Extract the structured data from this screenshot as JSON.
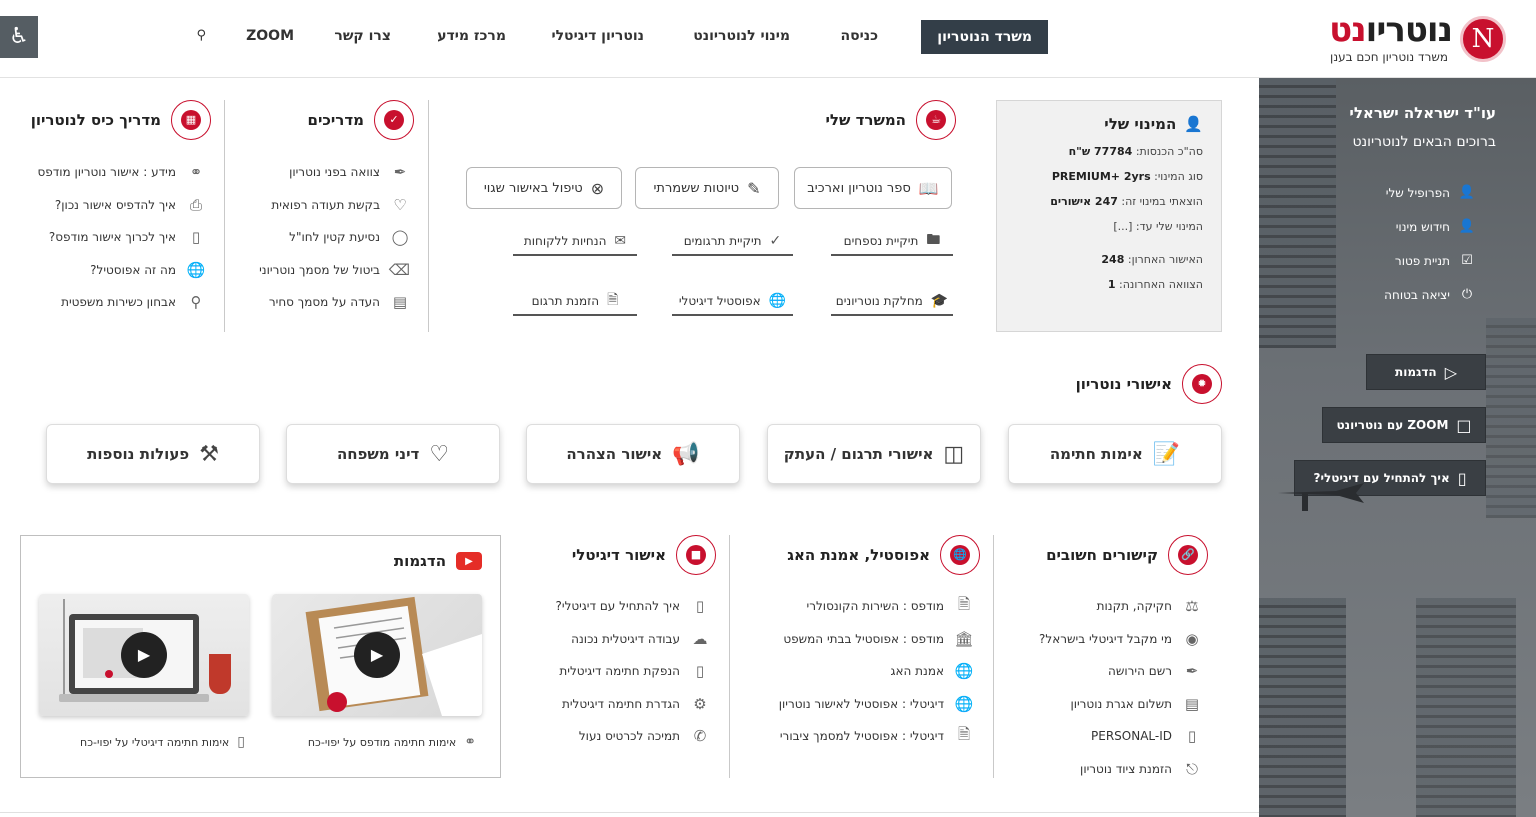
{
  "header": {
    "logo_main": "נוטריו",
    "logo_tail": "נט",
    "logo_letter": "N",
    "logo_sub": "משרד נוטריון חכם בענן",
    "nav_primary": "משרד הנוטריון",
    "nav": [
      "כניסה",
      "מינוי לנוטריונט",
      "נוטריון דיגיטלי",
      "מרכז מידע",
      "צרו קשר",
      "ZOOM"
    ],
    "search_icon": "search-icon",
    "accessibility_icon": "wheelchair-icon"
  },
  "sidebar": {
    "greeting": "עו\"ד ישראלה ישראלי",
    "welcome": "ברוכים הבאים לנוטריונט",
    "items": [
      {
        "label": "הפרופיל שלי",
        "icon": "user-gear-icon"
      },
      {
        "label": "חידוש מינוי",
        "icon": "user-plus-icon"
      },
      {
        "label": "תניית פטור",
        "icon": "checkbox-icon"
      },
      {
        "label": "יציאה בטוחה",
        "icon": "power-icon"
      }
    ],
    "buttons": [
      {
        "label": "הדגמות",
        "icon": "play-circle-icon"
      },
      {
        "label": "ZOOM עם נוטריונט",
        "icon": "video-camera-icon"
      },
      {
        "label": "איך להתחיל עם דיגיטלי?",
        "icon": "usb-key-icon"
      }
    ]
  },
  "my_subscription": {
    "title": "המינוי שלי",
    "rows": [
      {
        "label": "סה\"כ הכנסות:",
        "value": "77784 ש\"ח"
      },
      {
        "label": "סוג המינוי:",
        "value": "PREMIUM+ 2yrs"
      },
      {
        "label": "הוצאתי במינוי זה:",
        "value": "247 אישורים"
      },
      {
        "label": "המינוי שלי עד:",
        "value": "[...]"
      },
      {
        "label": "האישור האחרון:",
        "value": "248"
      },
      {
        "label": "הצוואה האחרונה:",
        "value": "1"
      }
    ]
  },
  "my_office": {
    "title": "המשרד שלי",
    "outline_buttons": [
      {
        "label": "ספר נוטריון וארכיב",
        "icon": "book-icon"
      },
      {
        "label": "טיוטות ששמרתי",
        "icon": "pencil-icon"
      },
      {
        "label": "טיפול באישור שגוי",
        "icon": "x-circle-icon"
      }
    ],
    "links": [
      {
        "label": "תיקיית נספחים",
        "icon": "folder-icon"
      },
      {
        "label": "תיקיית תרגומים",
        "icon": "abc-check-icon"
      },
      {
        "label": "הנחיות ללקוחות",
        "icon": "envelope-icon"
      },
      {
        "label": "מחלקת נוטריונים",
        "icon": "graduation-cap-icon"
      },
      {
        "label": "אפוסטיל דיגיטלי",
        "icon": "globe-icon"
      },
      {
        "label": "הזמנת תרגום",
        "icon": "document-icon"
      }
    ]
  },
  "guides": {
    "title": "מדריכים",
    "items": [
      {
        "label": "צוואה בפני נוטריון",
        "icon": "quill-icon"
      },
      {
        "label": "בקשת תעודה רפואית",
        "icon": "heart-pulse-icon"
      },
      {
        "label": "נסיעת קטין לחו\"ל",
        "icon": "balloon-icon"
      },
      {
        "label": "ביטול של מסמך נוטריוני",
        "icon": "backspace-icon"
      },
      {
        "label": "העדה על מסמך סחיר",
        "icon": "cheque-icon"
      }
    ]
  },
  "pocket_guide": {
    "title": "מדריך כיס לנוטריון",
    "items": [
      {
        "label": "מידע : אישור נוטריון מודפס",
        "icon": "ribbon-icon"
      },
      {
        "label": "איך להדפיס אישור נכון?",
        "icon": "printer-icon"
      },
      {
        "label": "איך לכרוך אישור מודפס?",
        "icon": "binder-icon"
      },
      {
        "label": "מה זה אפוסטיל?",
        "icon": "globe-icon"
      },
      {
        "label": "אבחון כשירות משפטית",
        "icon": "lightbulb-icon"
      }
    ]
  },
  "notary_approvals": {
    "title": "אישורי נוטריון",
    "buttons": [
      {
        "label": "אימות חתימה",
        "icon": "sign-document-icon"
      },
      {
        "label": "אישורי תרגום / העתק",
        "icon": "translate-icon"
      },
      {
        "label": "אישור הצהרה",
        "icon": "megaphone-icon"
      },
      {
        "label": "דיני משפחה",
        "icon": "heart-icon"
      },
      {
        "label": "פעולות נוספות",
        "icon": "tools-icon"
      }
    ]
  },
  "important_links": {
    "title": "קישורים חשובים",
    "items": [
      {
        "label": "חקיקה, תקנות",
        "icon": "scales-icon"
      },
      {
        "label": "מי מקבל דיגיטלי בישראל?",
        "icon": "lock-circle-icon"
      },
      {
        "label": "רשם הירושה",
        "icon": "quill-icon"
      },
      {
        "label": "תשלום אגרת נוטריון",
        "icon": "id-card-icon"
      },
      {
        "label": "PERSONAL-ID",
        "icon": "usb-key-icon"
      },
      {
        "label": "הזמנת ציוד נוטריון",
        "icon": "stamp-icon"
      }
    ]
  },
  "apostille": {
    "title": "אפוסטיל, אמנת האג",
    "items": [
      {
        "label": "מודפס : השירות הקונסולרי",
        "icon": "document-check-icon"
      },
      {
        "label": "מודפס : אפוסטיל בבתי המשפט",
        "icon": "courthouse-icon"
      },
      {
        "label": "אמנת האג",
        "icon": "globe-icon"
      },
      {
        "label": "דיגיטלי : אפוסטיל לאישור נוטריון",
        "icon": "globe-check-icon"
      },
      {
        "label": "דיגיטלי : אפוסטיל למסמך ציבורי",
        "icon": "document-lock-icon"
      }
    ]
  },
  "digital_approval": {
    "title": "אישור דיגיטלי",
    "items": [
      {
        "label": "איך להתחיל עם דיגיטלי?",
        "icon": "usb-key-icon"
      },
      {
        "label": "עבודה דיגיטלית נכונה",
        "icon": "cloud-icon"
      },
      {
        "label": "הנפקת חתימה דיגיטלית",
        "icon": "usb-key-icon"
      },
      {
        "label": "הגדרת חתימה דיגיטלית",
        "icon": "gear-icon"
      },
      {
        "label": "תמיכה לכרטיס נעול",
        "icon": "phone-icon"
      }
    ]
  },
  "demos": {
    "title": "הדגמות",
    "videos": [
      {
        "caption": "אימות חתימה מודפס על יפוי-כח",
        "icon": "ribbon-icon"
      },
      {
        "caption": "אימות חתימה דיגיטלי על יפוי-כח",
        "icon": "usb-key-icon"
      }
    ]
  },
  "colors": {
    "brand_red": "#c8102e",
    "nav_dark": "#333e48",
    "sidebar_gray": "#6b7075"
  }
}
